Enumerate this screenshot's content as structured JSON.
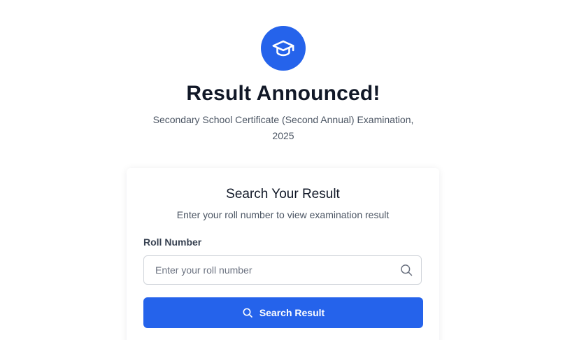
{
  "header": {
    "logo_icon": "graduation-cap-icon",
    "title": "Result Announced!",
    "subtitle": "Secondary School Certificate (Second Annual) Examination, 2025"
  },
  "search_card": {
    "title": "Search Your Result",
    "description": "Enter your roll number to view examination result",
    "roll_label": "Roll Number",
    "roll_placeholder": "Enter your roll number",
    "roll_value": "",
    "input_icon": "search-icon",
    "button_label": "Search Result",
    "button_icon": "search-icon"
  },
  "colors": {
    "accent": "#2563eb",
    "heading": "#111827",
    "muted": "#4b5563",
    "border": "#d1d5db"
  }
}
